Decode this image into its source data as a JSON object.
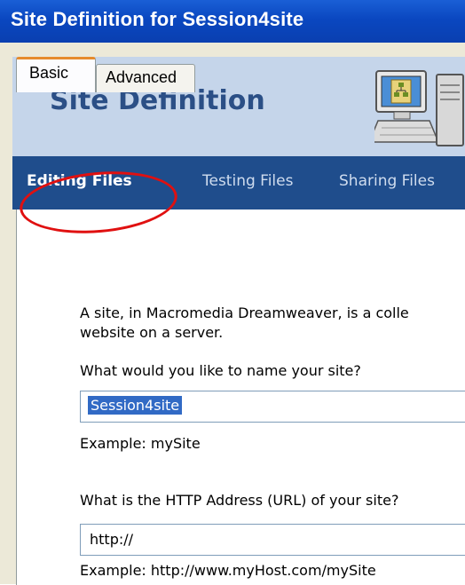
{
  "window": {
    "title": "Site Definition for Session4site"
  },
  "tabs": [
    {
      "label": "Basic",
      "selected": true
    },
    {
      "label": "Advanced",
      "selected": false
    }
  ],
  "banner": {
    "heading": "Site Definition",
    "icon": "computer-network-icon"
  },
  "nav": {
    "items": [
      {
        "label": "Editing Files",
        "active": true
      },
      {
        "label": "Testing Files",
        "active": false
      },
      {
        "label": "Sharing Files",
        "active": false
      }
    ]
  },
  "form": {
    "intro_line1": "A site, in Macromedia Dreamweaver, is a colle",
    "intro_line2": "website on a server.",
    "name_question": "What would you like to name your site?",
    "name_value": "Session4site",
    "name_example": "Example: mySite",
    "url_question": "What is the HTTP Address (URL) of your site?",
    "url_value": "http://",
    "url_example": "Example: http://www.myHost.com/mySite"
  },
  "colors": {
    "titlebar": "#0a47c0",
    "banner_bg": "#c5d5ea",
    "nav_bg": "#1f4d8c",
    "annotation": "#e01010",
    "selection": "#316ac5"
  }
}
